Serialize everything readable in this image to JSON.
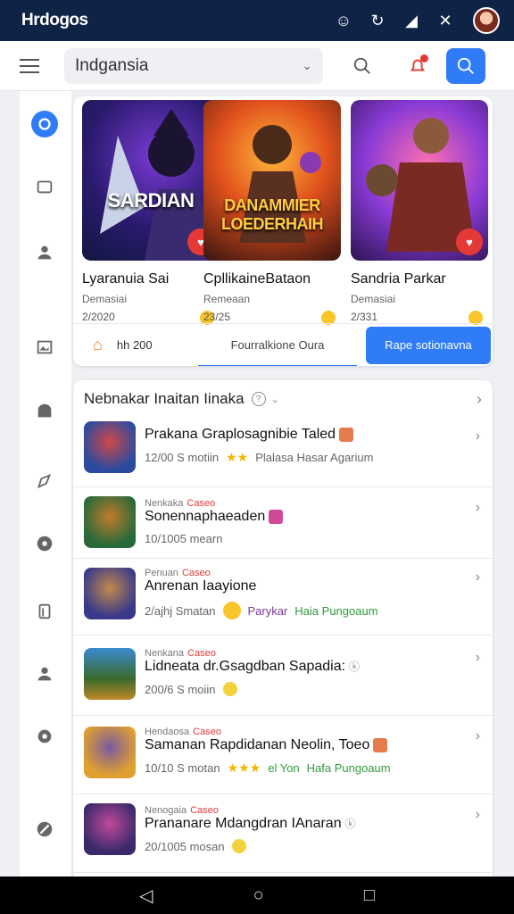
{
  "status": {
    "title": "Hrdogos"
  },
  "topbar": {
    "search_value": "Indgansia"
  },
  "featured": {
    "games": [
      {
        "art_title": "SARDIAN",
        "name": "Lyaranuia Sai",
        "sub": "Demasiai",
        "count": "2/2020"
      },
      {
        "art_title": "DANAMMIER LOEDERHAIH",
        "name": "CpllikaineBataon",
        "sub": "Remeaan",
        "count": "23/25"
      },
      {
        "art_title": "",
        "name": "Sandria Parkar",
        "sub": "Demasiai",
        "count": "2/331"
      }
    ],
    "bar_left": "hh 200",
    "bar_mid": "Fourralkione Oura",
    "bar_button": "Rape sotionavna"
  },
  "list": {
    "header": "Nebnakar Inaitan Iinaka",
    "rows": [
      {
        "kicker": "",
        "tag": "",
        "name": "Prakana Graplosagnibie Taled",
        "meta": "12/00 S motiin",
        "extra": "Plalasa Hasar Agarium"
      },
      {
        "kicker": "Nenkaka",
        "tag": "Caseo",
        "name": "Sonennaphaeaden",
        "meta": "10/1005 mearn",
        "extra": ""
      },
      {
        "kicker": "Penuan",
        "tag": "Caseo",
        "name": "Anrenan Iaayione",
        "meta": "2/ajhj Smatan",
        "extra": "Haia Pungoaum",
        "extra_prefix": "Parykar"
      },
      {
        "kicker": "Nenkana",
        "tag": "Caseo",
        "name": "Lidneata dr.Gsagdban Sapadia:",
        "meta": "200/6 S moiin",
        "extra": ""
      },
      {
        "kicker": "Hendaosa",
        "tag": "Caseo",
        "name": "Samanan Rapdidanan Neolin, Toeo",
        "meta": "10/10 S motan",
        "extra": "Hafa Pungoaum",
        "extra_prefix": "el Yon"
      },
      {
        "kicker": "Nenogaia",
        "tag": "Caseo",
        "name": "Prananare Mdangdran IAnaran",
        "meta": "20/1005 mosan",
        "extra": ""
      }
    ]
  },
  "colors": {
    "accent": "#2f7cf6",
    "status_bg": "#0f2347",
    "alert": "#e53935",
    "positive": "#2e9b3a"
  }
}
